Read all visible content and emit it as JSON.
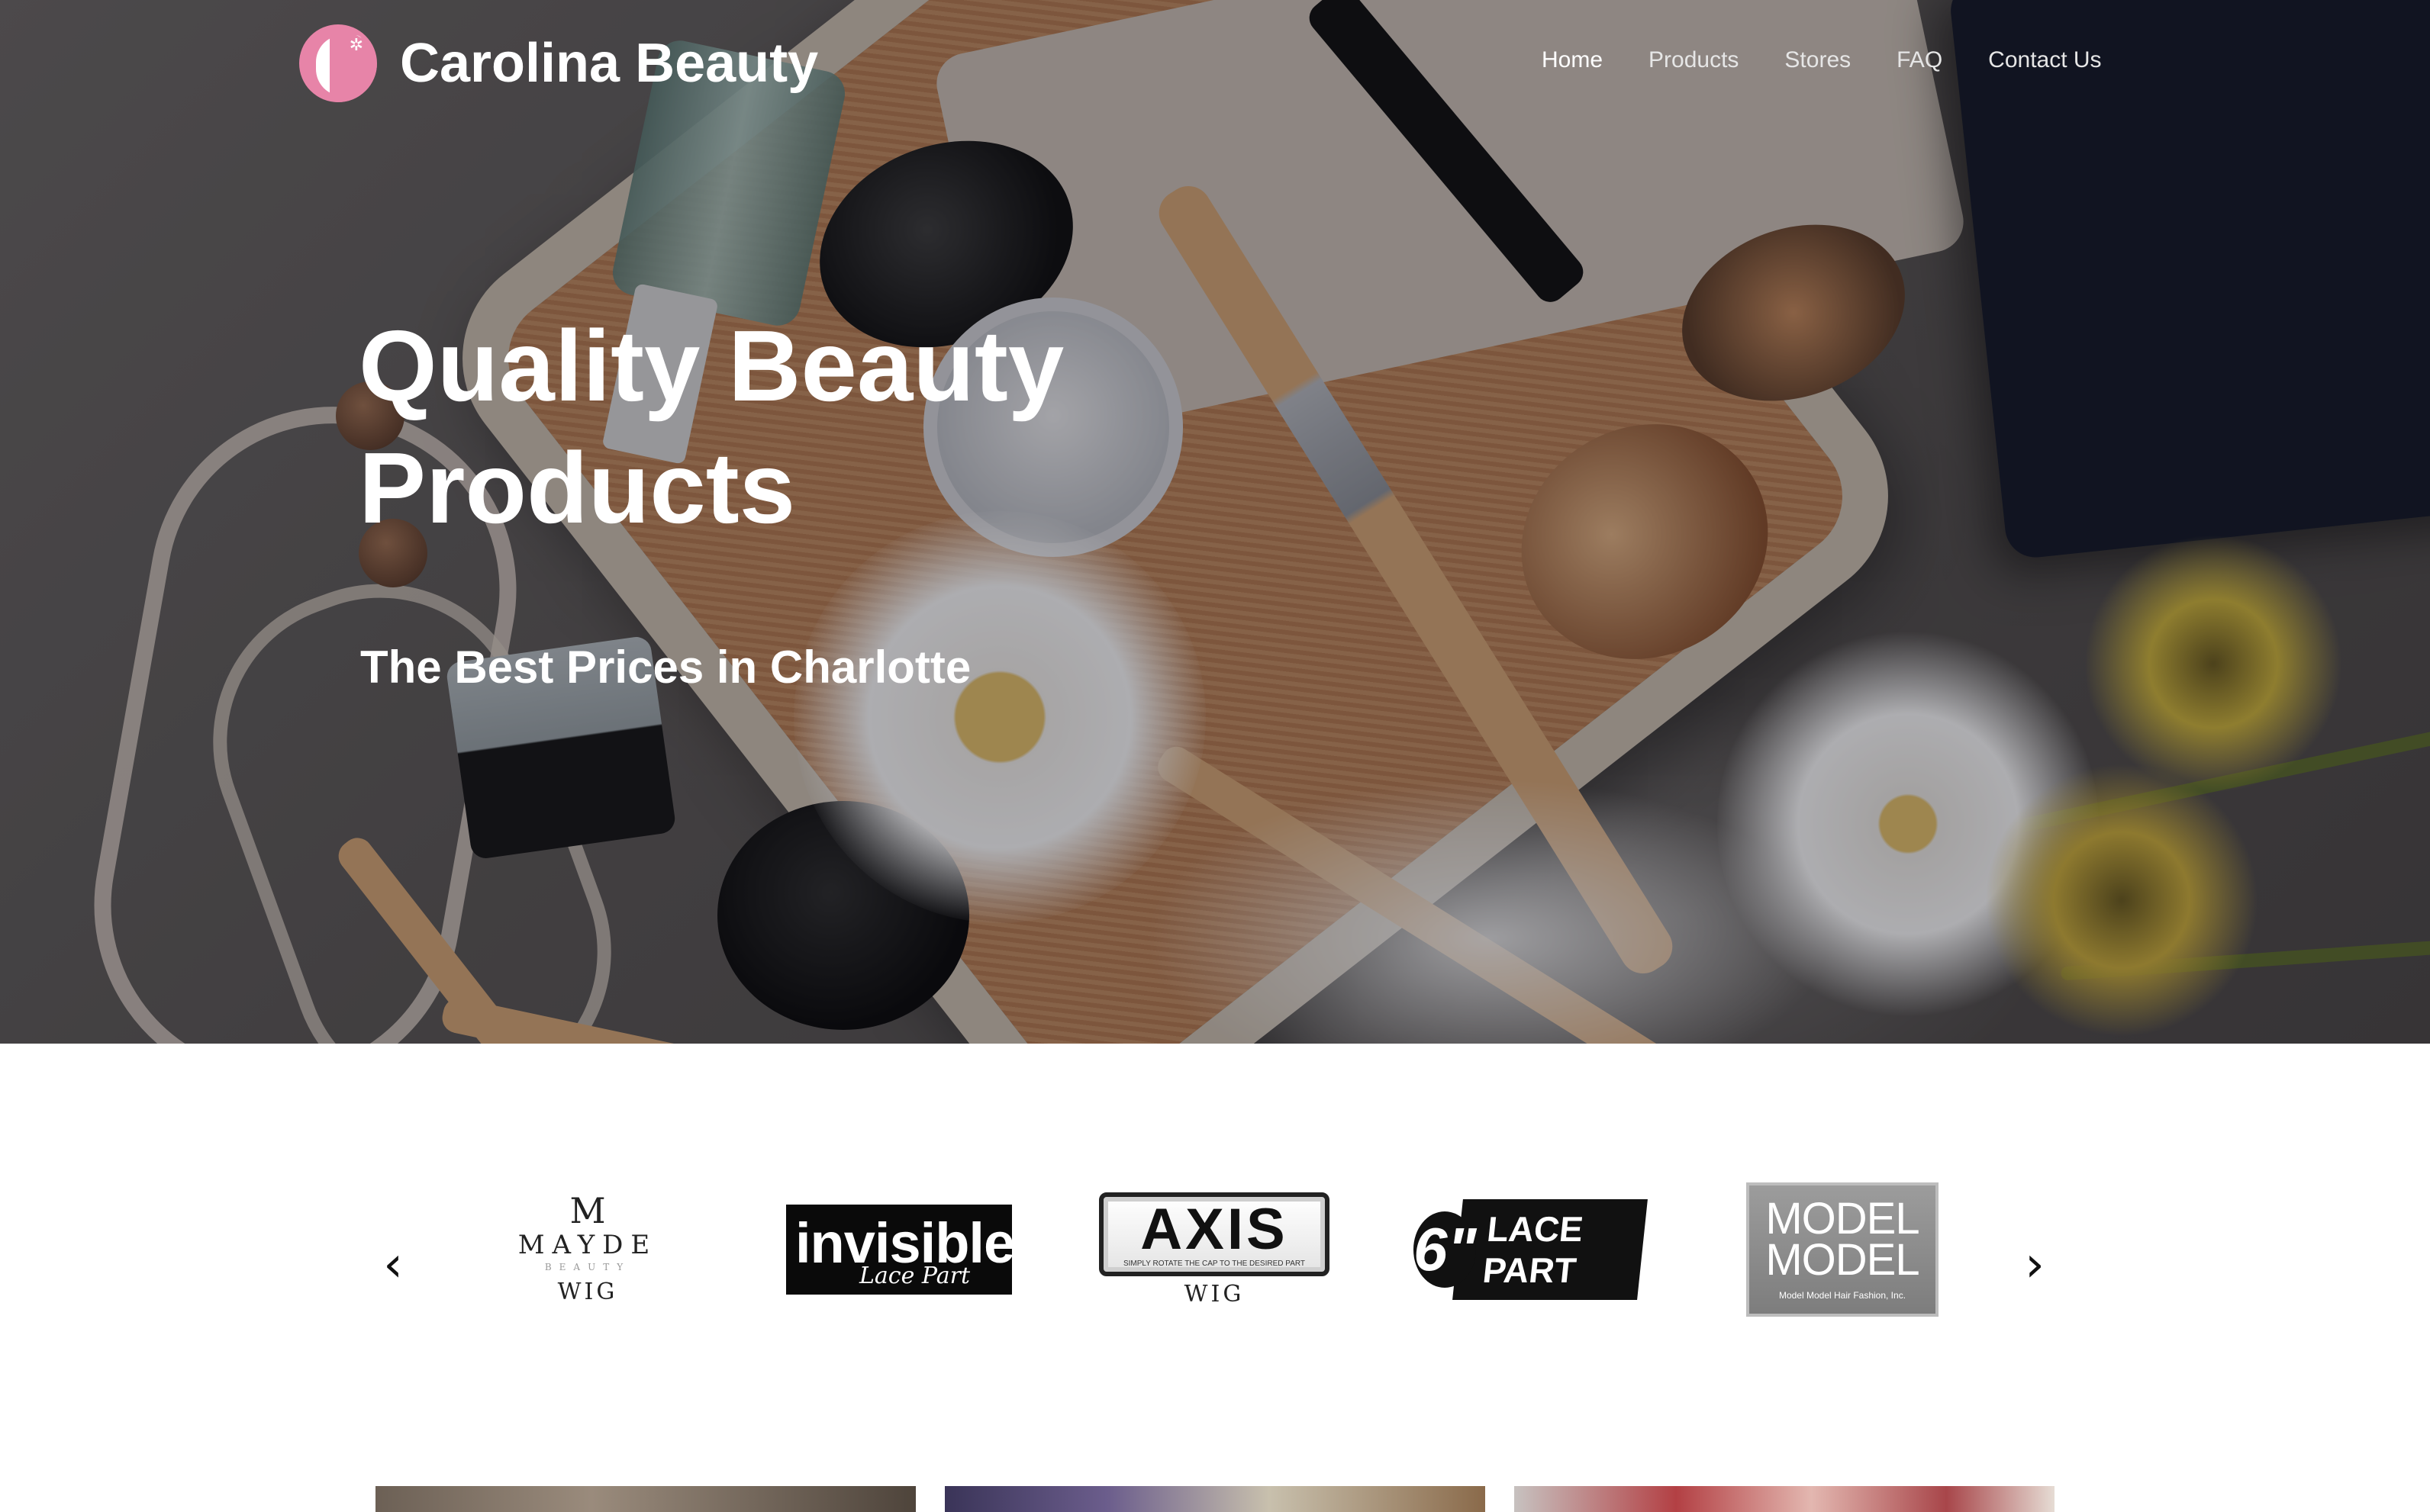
{
  "header": {
    "brand_name": "Carolina Beauty",
    "logo_icon": "woman-silhouette-icon",
    "nav": [
      {
        "label": "Home",
        "active": true
      },
      {
        "label": "Products",
        "active": false
      },
      {
        "label": "Stores",
        "active": false
      },
      {
        "label": "FAQ",
        "active": false
      },
      {
        "label": "Contact Us",
        "active": false
      }
    ]
  },
  "hero": {
    "title": "Quality Beauty Products",
    "subtitle": "The Best Prices in Charlotte"
  },
  "brands": {
    "prev_icon": "chevron-left-icon",
    "next_icon": "chevron-right-icon",
    "items": [
      {
        "name": "MAYDE",
        "sub": "BEAUTY",
        "suffix": "WIG"
      },
      {
        "name": "invisible",
        "sub": "Lace Part"
      },
      {
        "name": "AXIS",
        "tagline": "SIMPLY ROTATE THE CAP TO THE DESIRED PART",
        "suffix": "WIG"
      },
      {
        "prefix": "6\"",
        "name": "LACE PART"
      },
      {
        "line1": "MODEL",
        "line2": "MODEL",
        "sub": "Model Model Hair Fashion, Inc."
      }
    ]
  },
  "colors": {
    "brand_pink": "#e784a8",
    "nav_text": "#e6e6e6",
    "white": "#ffffff"
  }
}
